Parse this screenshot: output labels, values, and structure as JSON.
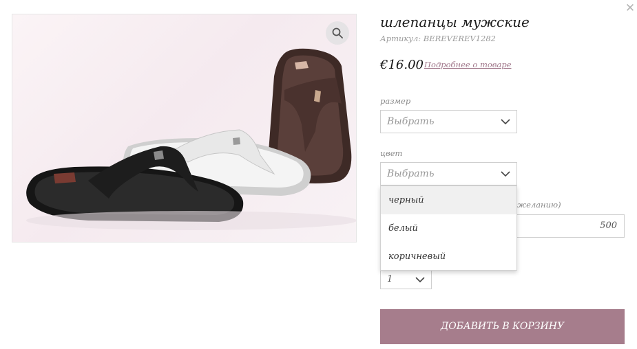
{
  "close_icon": "close-icon",
  "product": {
    "title": "шлепанцы мужские",
    "sku": "Артикул: BEREVEREV1282",
    "price": "€16.00",
    "details_link": "Подробнее о товаре",
    "image_alt": "sandals-photo"
  },
  "size": {
    "label": "размер",
    "value": "Выбрать"
  },
  "color": {
    "label": "цвет",
    "value": "Выбрать",
    "options": [
      "черный",
      "белый",
      "коричневый"
    ]
  },
  "custom_amount": {
    "label_visible_part": "желанию)",
    "value": "500"
  },
  "quantity": {
    "value": "1"
  },
  "add_to_cart": "ДОБАВИТЬ В КОРЗИНУ",
  "colors": {
    "accent": "#a67d8c",
    "link": "#a0778a"
  }
}
